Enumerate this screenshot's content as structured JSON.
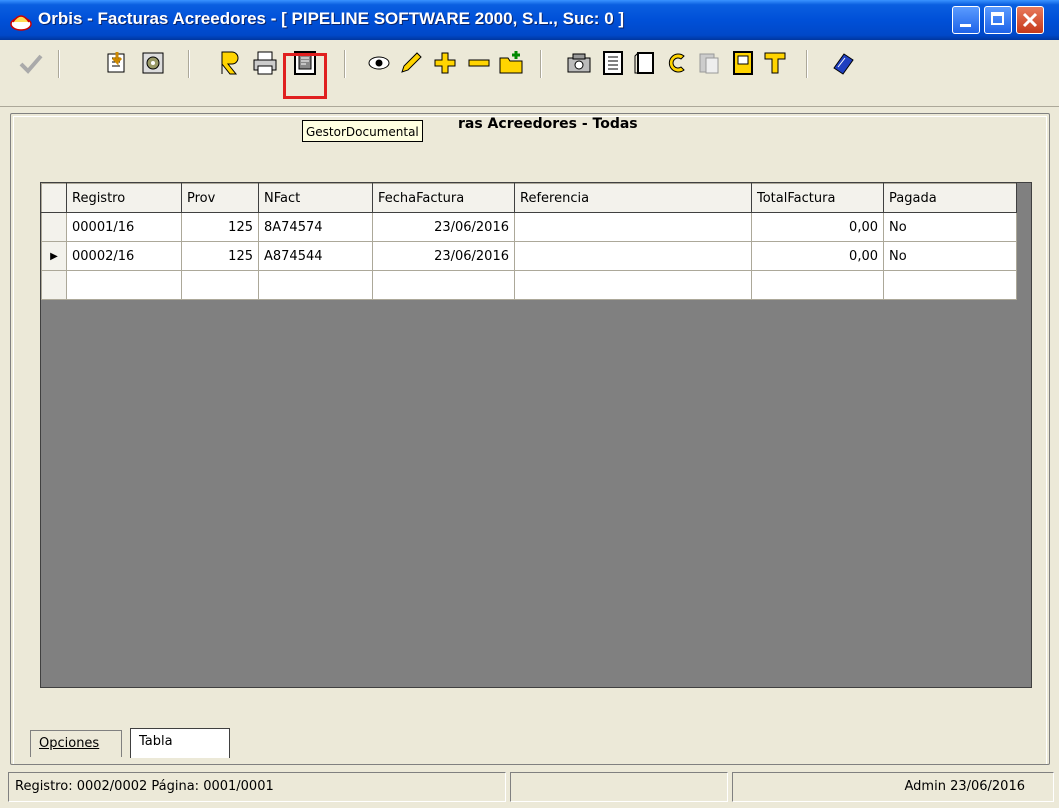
{
  "window": {
    "title": "Orbis - Facturas Acreedores - [ PIPELINE SOFTWARE 2000, S.L.,  Suc: 0 ]",
    "icons": [
      "app-icon",
      "minimize-icon",
      "maximize-icon",
      "close-icon"
    ]
  },
  "toolbar": {
    "items": [
      "accept-check-icon",
      "import-icon",
      "settings-icon",
      "report-icon",
      "print-icon",
      "gestor-documental-icon",
      "view-eye-icon",
      "edit-pencil-icon",
      "add-plus-icon",
      "remove-minus-icon",
      "new-folder-icon",
      "camera-icon",
      "list-icon",
      "copy-icon",
      "c-letter-icon",
      "paste-icon",
      "document-icon",
      "t-letter-icon",
      "help-book-icon"
    ],
    "tooltip": "GestorDocumental",
    "highlighted": "gestor-documental-icon"
  },
  "view": {
    "title": "ras Acreedores - Todas"
  },
  "grid": {
    "columns": [
      "Registro",
      "Prov",
      "NFact",
      "FechaFactura",
      "Referencia",
      "TotalFactura",
      "Pagada"
    ],
    "rows": [
      {
        "registro": "00001/16",
        "prov": "125",
        "nfact": "8A74574",
        "fecha": "23/06/2016",
        "referencia": "",
        "total": "0,00",
        "pagada": "No",
        "current": false
      },
      {
        "registro": "00002/16",
        "prov": "125",
        "nfact": "A874544",
        "fecha": "23/06/2016",
        "referencia": "",
        "total": "0,00",
        "pagada": "No",
        "current": true
      }
    ],
    "row_indicator": "▶"
  },
  "tabs": [
    {
      "label": "Opciones",
      "active": false
    },
    {
      "label": "Tabla",
      "active": true
    }
  ],
  "status": {
    "left": "Registro: 0002/0002  Página: 0001/0001",
    "middle": "",
    "right": "Admin 23/06/2016"
  },
  "colors": {
    "titlebar": "#0050D8",
    "highlight": "#E02020",
    "grid_background": "#808080",
    "tooltip_bg": "#FFFFE1"
  }
}
